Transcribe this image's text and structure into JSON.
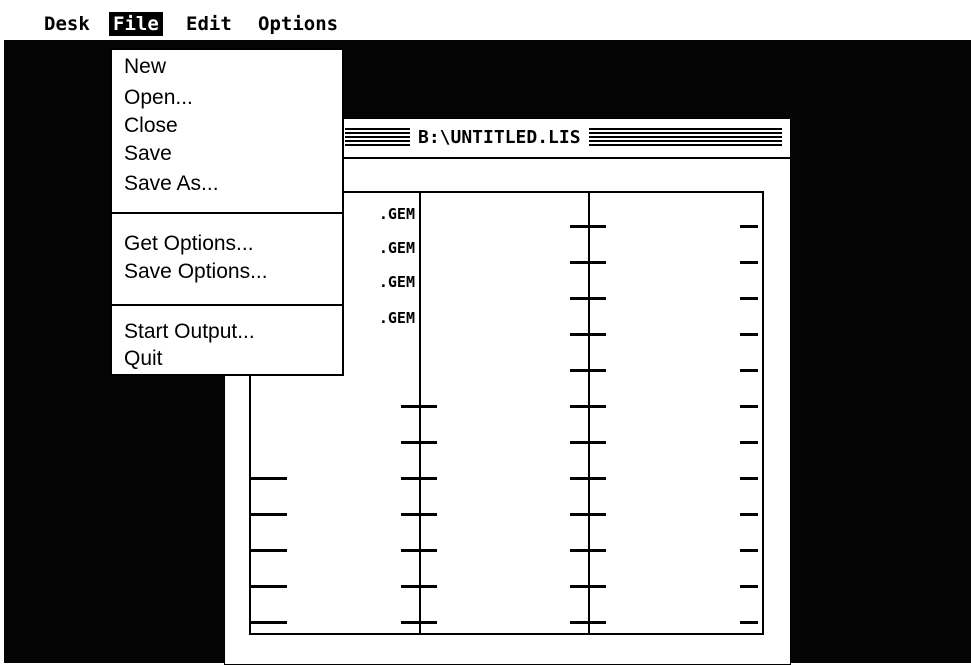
{
  "menubar": {
    "items": [
      {
        "label": "Desk"
      },
      {
        "label": "File",
        "active": true
      },
      {
        "label": "Edit"
      },
      {
        "label": "Options"
      }
    ]
  },
  "file_menu": {
    "items": [
      {
        "label": "New"
      },
      {
        "label": "Open..."
      },
      {
        "label": "Close"
      },
      {
        "label": "Save"
      },
      {
        "label": "Save As..."
      },
      {
        "label": "Get Options..."
      },
      {
        "label": "Save Options..."
      },
      {
        "label": "Start Output..."
      },
      {
        "label": "Quit"
      }
    ]
  },
  "window": {
    "title": "B:\\UNTITLED.LIS"
  },
  "list": {
    "entries": [
      ".GEM",
      ".GEM",
      ".GEM",
      ".GEM"
    ]
  },
  "colors": {
    "desktop": "#050505",
    "window": "#ffffff",
    "text": "#000000"
  }
}
